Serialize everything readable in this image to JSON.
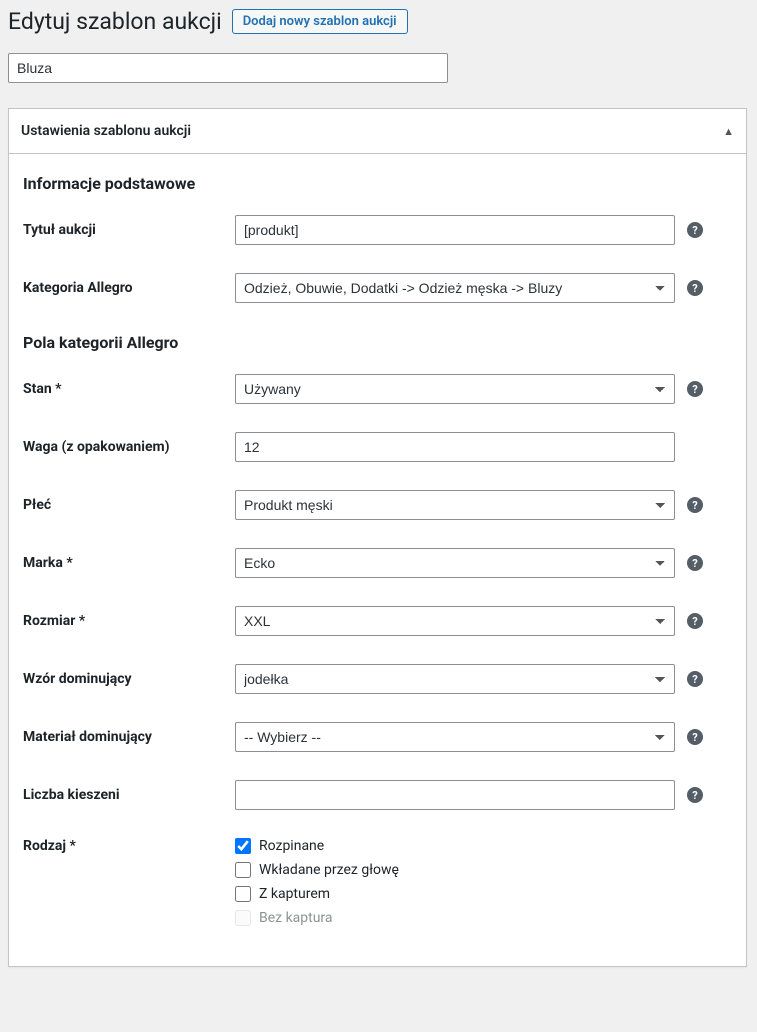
{
  "page": {
    "title": "Edytuj szablon aukcji",
    "add_new": "Dodaj nowy szablon aukcji"
  },
  "post": {
    "title": "Bluza"
  },
  "panel": {
    "title": "Ustawienia szablonu aukcji"
  },
  "sections": {
    "basic": "Informacje podstawowe",
    "category_fields": "Pola kategorii Allegro"
  },
  "fields": {
    "auction_title": {
      "label": "Tytuł aukcji",
      "value": "[produkt]"
    },
    "category": {
      "label": "Kategoria Allegro",
      "value": "Odzież, Obuwie, Dodatki -> Odzież męska -> Bluzy"
    },
    "condition": {
      "label": "Stan *",
      "value": "Używany"
    },
    "weight": {
      "label": "Waga (z opakowaniem)",
      "value": "12"
    },
    "gender": {
      "label": "Płeć",
      "value": "Produkt męski"
    },
    "brand": {
      "label": "Marka *",
      "value": "Ecko"
    },
    "size": {
      "label": "Rozmiar *",
      "value": "XXL"
    },
    "pattern": {
      "label": "Wzór dominujący",
      "value": "jodełka"
    },
    "material": {
      "label": "Materiał dominujący",
      "value": "-- Wybierz --"
    },
    "pockets": {
      "label": "Liczba kieszeni",
      "value": ""
    },
    "type": {
      "label": "Rodzaj *",
      "options": [
        {
          "label": "Rozpinane",
          "checked": true
        },
        {
          "label": "Wkładane przez głowę",
          "checked": false
        },
        {
          "label": "Z kapturem",
          "checked": false
        },
        {
          "label": "Bez kaptura",
          "checked": false,
          "disabled": true
        }
      ]
    }
  }
}
